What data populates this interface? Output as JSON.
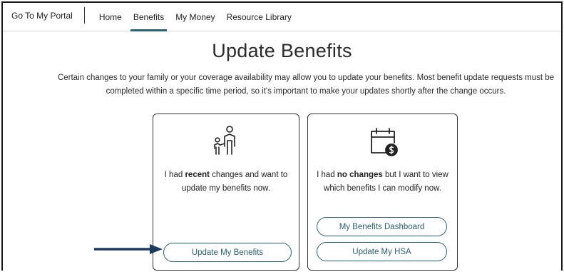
{
  "nav": {
    "portal_label": "Go To My Portal",
    "tabs": [
      {
        "label": "Home",
        "active": false
      },
      {
        "label": "Benefits",
        "active": true
      },
      {
        "label": "My Money",
        "active": false
      },
      {
        "label": "Resource Library",
        "active": false
      }
    ]
  },
  "page": {
    "title": "Update Benefits",
    "intro": "Certain changes to your family or your coverage availability may allow you to update your benefits. Most benefit update requests must be completed within a specific time period, so it's important to make your updates shortly after the change occurs."
  },
  "cards": {
    "recent": {
      "icon": "parent-child-icon",
      "text_pre": "I had ",
      "text_bold": "recent",
      "text_post": " changes and want to update my benefits now.",
      "button": "Update My Benefits"
    },
    "none": {
      "icon": "calendar-dollar-icon",
      "text_pre": "I had ",
      "text_bold": "no changes",
      "text_post": " but I want to view which benefits I can modify now.",
      "button_dashboard": "My Benefits Dashboard",
      "button_hsa": "Update My HSA"
    }
  },
  "annotation": {
    "arrow": "pointer-arrow-icon"
  },
  "colors": {
    "accent": "#2c5f6e",
    "arrow": "#1f3a5f",
    "border": "#333333"
  }
}
